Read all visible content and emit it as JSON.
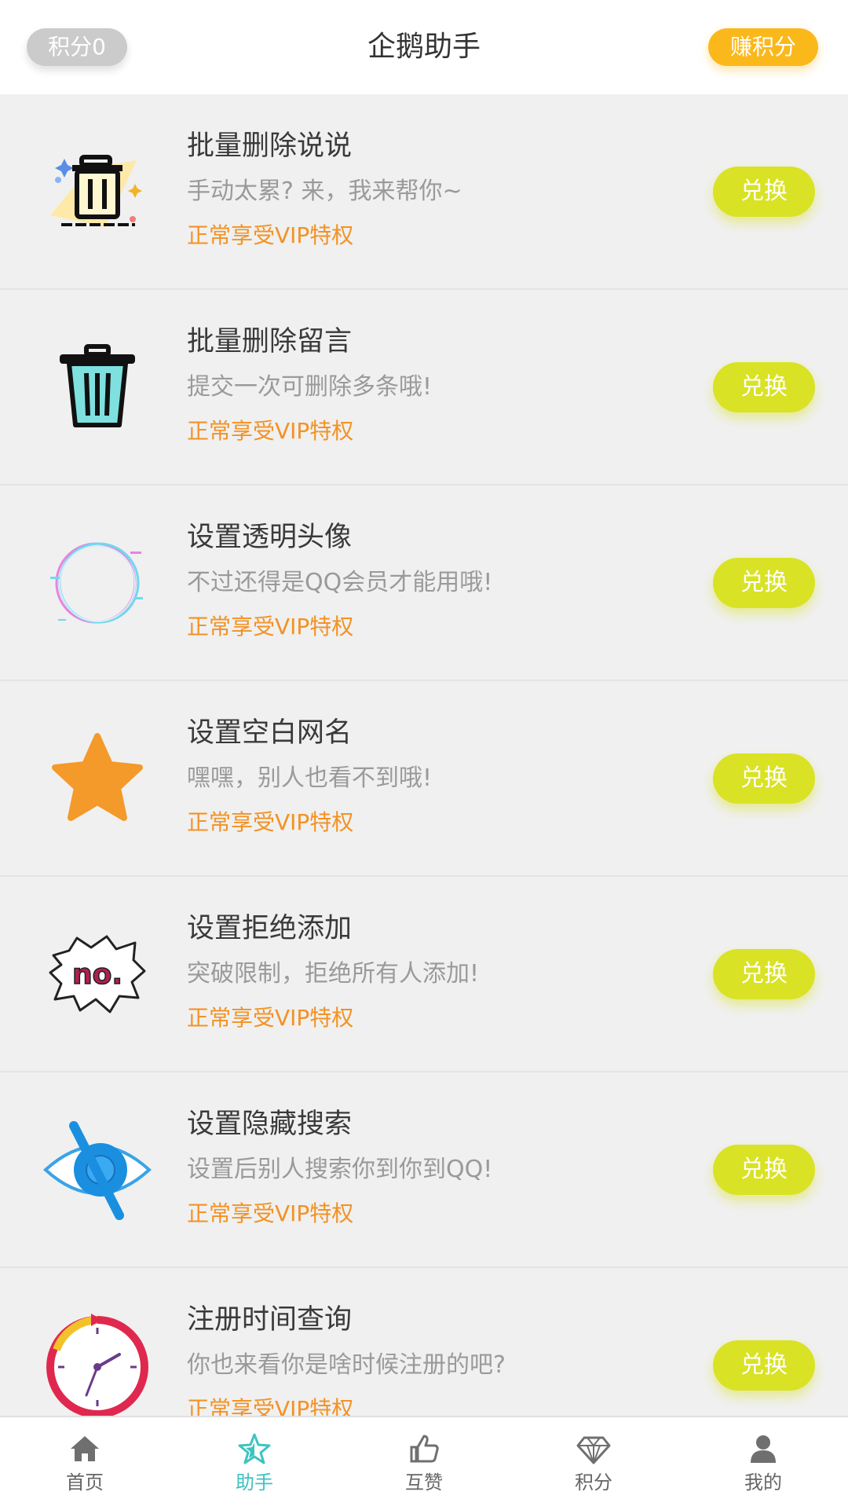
{
  "header": {
    "points_label": "积分0",
    "title": "企鹅助手",
    "earn_label": "赚积分"
  },
  "items": [
    {
      "name": "批量删除说说",
      "desc": "手动太累? 来，我来帮你~",
      "vip": "正常享受VIP特权",
      "button": "兑换",
      "icon": "trash-can-sparkle-icon"
    },
    {
      "name": "批量删除留言",
      "desc": "提交一次可删除多条哦!",
      "vip": "正常享受VIP特权",
      "button": "兑换",
      "icon": "trash-can-icon"
    },
    {
      "name": "设置透明头像",
      "desc": "不过还得是QQ会员才能用哦!",
      "vip": "正常享受VIP特权",
      "button": "兑换",
      "icon": "glitch-circle-icon"
    },
    {
      "name": "设置空白网名",
      "desc": "嘿嘿，别人也看不到哦!",
      "vip": "正常享受VIP特权",
      "button": "兑换",
      "icon": "star-icon"
    },
    {
      "name": "设置拒绝添加",
      "desc": "突破限制，拒绝所有人添加!",
      "vip": "正常享受VIP特权",
      "button": "兑换",
      "icon": "no-bubble-icon"
    },
    {
      "name": "设置隐藏搜索",
      "desc": "设置后别人搜索你到你到QQ!",
      "vip": "正常享受VIP特权",
      "button": "兑换",
      "icon": "hidden-eye-icon"
    },
    {
      "name": "注册时间查询",
      "desc": "你也来看你是啥时候注册的吧?",
      "vip": "正常享受VIP特权",
      "button": "兑换",
      "icon": "clock-icon"
    }
  ],
  "tabs": [
    {
      "label": "首页",
      "icon": "home-icon",
      "active": false
    },
    {
      "label": "助手",
      "icon": "star-outline-icon",
      "active": true
    },
    {
      "label": "互赞",
      "icon": "thumbs-up-icon",
      "active": false
    },
    {
      "label": "积分",
      "icon": "diamond-icon",
      "active": false
    },
    {
      "label": "我的",
      "icon": "user-icon",
      "active": false
    }
  ],
  "colors": {
    "accent_orange": "#f39224",
    "earn_button": "#fbb81b",
    "redeem_button": "#d9e224",
    "active_tab": "#3ec3c0"
  }
}
